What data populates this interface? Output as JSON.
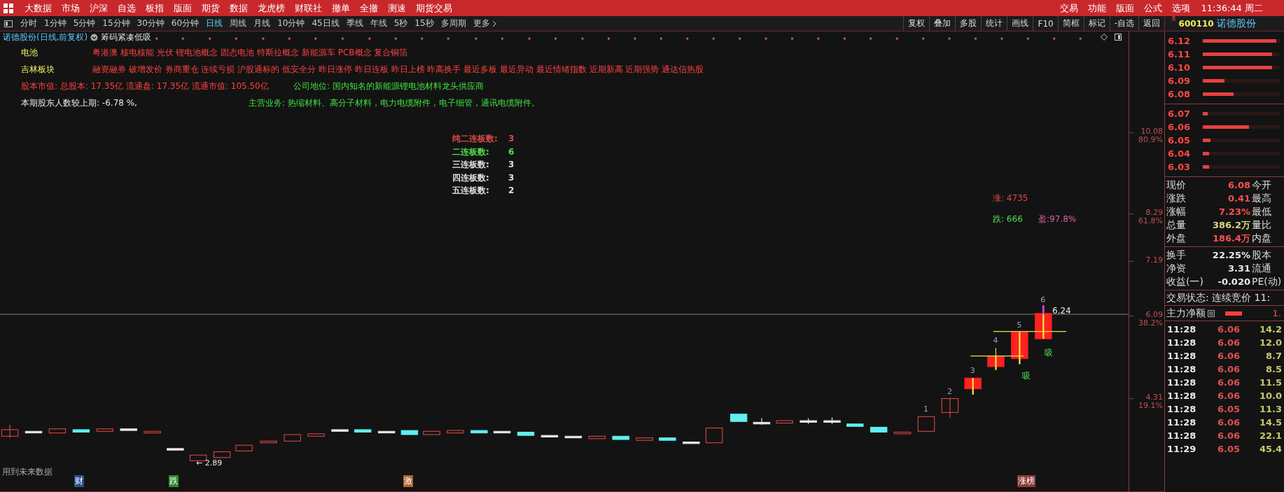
{
  "menu_bar": {
    "items": [
      "大数据",
      "市场",
      "沪深",
      "自选",
      "板指",
      "版面",
      "期货",
      "数据",
      "龙虎榜",
      "财联社",
      "撤单",
      "全撤",
      "测速",
      "期货交易"
    ],
    "right_items": [
      "交易",
      "功能",
      "版面",
      "公式",
      "选项"
    ],
    "clock": "11:36:44 周二"
  },
  "period_tabs": [
    {
      "label": "分时",
      "selected": false
    },
    {
      "label": "1分钟",
      "selected": false
    },
    {
      "label": "5分钟",
      "selected": false
    },
    {
      "label": "15分钟",
      "selected": false
    },
    {
      "label": "30分钟",
      "selected": false
    },
    {
      "label": "60分钟",
      "selected": false
    },
    {
      "label": "日线",
      "selected": true
    },
    {
      "label": "周线",
      "selected": false
    },
    {
      "label": "月线",
      "selected": false
    },
    {
      "label": "10分钟",
      "selected": false
    },
    {
      "label": "45日线",
      "selected": false
    },
    {
      "label": "季线",
      "selected": false
    },
    {
      "label": "年线",
      "selected": false
    },
    {
      "label": "5秒",
      "selected": false
    },
    {
      "label": "15秒",
      "selected": false
    },
    {
      "label": "多周期",
      "selected": false
    },
    {
      "label": "更多",
      "selected": false
    }
  ],
  "tool_buttons": [
    "复权",
    "叠加",
    "多股",
    "统计",
    "画线",
    "F10",
    "简框",
    "标记",
    "-自选",
    "返回"
  ],
  "stock_header": {
    "badge": "R",
    "code": "600110",
    "name": "诺德股份"
  },
  "chart": {
    "title": "诺德股份(日线,前复权)",
    "indicator": "筹码紧凑低吸",
    "info_rows": [
      {
        "label": "电池",
        "text": "粤港澳 核电核能 光伏 锂电池概念 固态电池 特斯拉概念 新能源车 PCB概念 复合铜箔"
      },
      {
        "label": "吉林板块",
        "text": "融资融券 破增发价 券商重仓 连续亏损 沪股通标的 低安全分 昨日涨停 昨日连板 昨日上榜 昨高换手 最近多板 最近异动 最近情绪指数 近期新高 近期强势 通达信热股"
      }
    ],
    "facts": [
      {
        "left": "股本市值: 总股本: 17.35亿 流通盘: 17.35亿 流通市值: 105.50亿",
        "right": "公司地位: 国内知名的新能源锂电池材料龙头供应商"
      },
      {
        "left": "本期股东人数较上期: -6.78 %,",
        "right": "主营业务: 热缩材料、高分子材料，电力电缆附件，电子细管，通讯电缆附件。"
      }
    ],
    "streak_table": [
      {
        "label": "纯二连板数:",
        "value": "3",
        "color": "#e04848"
      },
      {
        "label": "二连板数:",
        "value": "6",
        "color": "#50e050"
      },
      {
        "label": "三连板数:",
        "value": "3",
        "color": "#e0e0e0"
      },
      {
        "label": "四连板数:",
        "value": "3",
        "color": "#e0e0e0"
      },
      {
        "label": "五连板数:",
        "value": "2",
        "color": "#e0e0e0"
      }
    ],
    "stats": {
      "up": "涨: 4735",
      "down": "跌: 666",
      "profit": "盈:97.8%"
    },
    "axis_labels": [
      {
        "price": "10.08",
        "pct": "80.9%"
      },
      {
        "price": "8.29",
        "pct": "61.8%"
      },
      {
        "price": "7.19"
      },
      {
        "price": "6.09",
        "pct": "38.2%"
      },
      {
        "price": "4.31",
        "pct": "19.1%"
      }
    ],
    "candle_labels": [
      "1",
      "2",
      "3",
      "4",
      "5",
      "6"
    ],
    "high_label": "6.24",
    "low_label": "← 2.89",
    "signal_labels": [
      "吸",
      "吸"
    ],
    "footnote": "用到未来数据",
    "bottom_tags": [
      {
        "label": "财",
        "color": "#2a4f8a"
      },
      {
        "label": "跌",
        "color": "#2f8a2f"
      },
      {
        "label": "激",
        "color": "#b0642a"
      },
      {
        "label": "涨榜",
        "color": "#8a3a3a"
      }
    ]
  },
  "order_book": {
    "sell": [
      {
        "price": "6.12",
        "level": 0.95
      },
      {
        "price": "6.11",
        "level": 0.9
      },
      {
        "price": "6.10",
        "level": 0.9
      },
      {
        "price": "6.09",
        "level": 0.28
      },
      {
        "price": "6.08",
        "level": 0.4
      }
    ],
    "buy": [
      {
        "price": "6.07",
        "level": 0.06
      },
      {
        "price": "6.06",
        "level": 0.6
      },
      {
        "price": "6.05",
        "level": 0.1
      },
      {
        "price": "6.04",
        "level": 0.08
      },
      {
        "price": "6.03",
        "level": 0.08
      }
    ]
  },
  "quote": [
    {
      "label": "现价",
      "value": "6.08",
      "label2": "今开",
      "color": "#ff5050"
    },
    {
      "label": "涨跌",
      "value": "0.41",
      "label2": "最高",
      "color": "#ff5050"
    },
    {
      "label": "涨幅",
      "value": "7.23%",
      "label2": "最低",
      "color": "#ff5050"
    },
    {
      "label": "总量",
      "value": "386.2万",
      "label2": "量比",
      "color": "#d8d880"
    },
    {
      "label": "外盘",
      "value": "186.4万",
      "label2": "内盘",
      "color": "#ff5050"
    }
  ],
  "fundamentals": [
    {
      "label": "换手",
      "value": "22.25%",
      "label2": "股本"
    },
    {
      "label": "净资",
      "value": "3.31",
      "label2": "流通"
    },
    {
      "label": "收益(一)",
      "value": "-0.020",
      "label2": "PE(动)"
    }
  ],
  "trade_status": "交易状态: 连续竞价 11:",
  "main_flow": {
    "label": "主力净额",
    "value": "1."
  },
  "ticks": [
    {
      "time": "11:28",
      "price": "6.06",
      "volume": "14.2"
    },
    {
      "time": "11:28",
      "price": "6.06",
      "volume": "12.0"
    },
    {
      "time": "11:28",
      "price": "6.06",
      "volume": "8.7"
    },
    {
      "time": "11:28",
      "price": "6.06",
      "volume": "8.5"
    },
    {
      "time": "11:28",
      "price": "6.06",
      "volume": "11.5"
    },
    {
      "time": "11:28",
      "price": "6.06",
      "volume": "10.0"
    },
    {
      "time": "11:28",
      "price": "6.05",
      "volume": "11.3"
    },
    {
      "time": "11:28",
      "price": "6.06",
      "volume": "14.5"
    },
    {
      "time": "11:28",
      "price": "6.06",
      "volume": "22.1"
    },
    {
      "time": "11:29",
      "price": "6.05",
      "volume": "45.4"
    }
  ]
}
